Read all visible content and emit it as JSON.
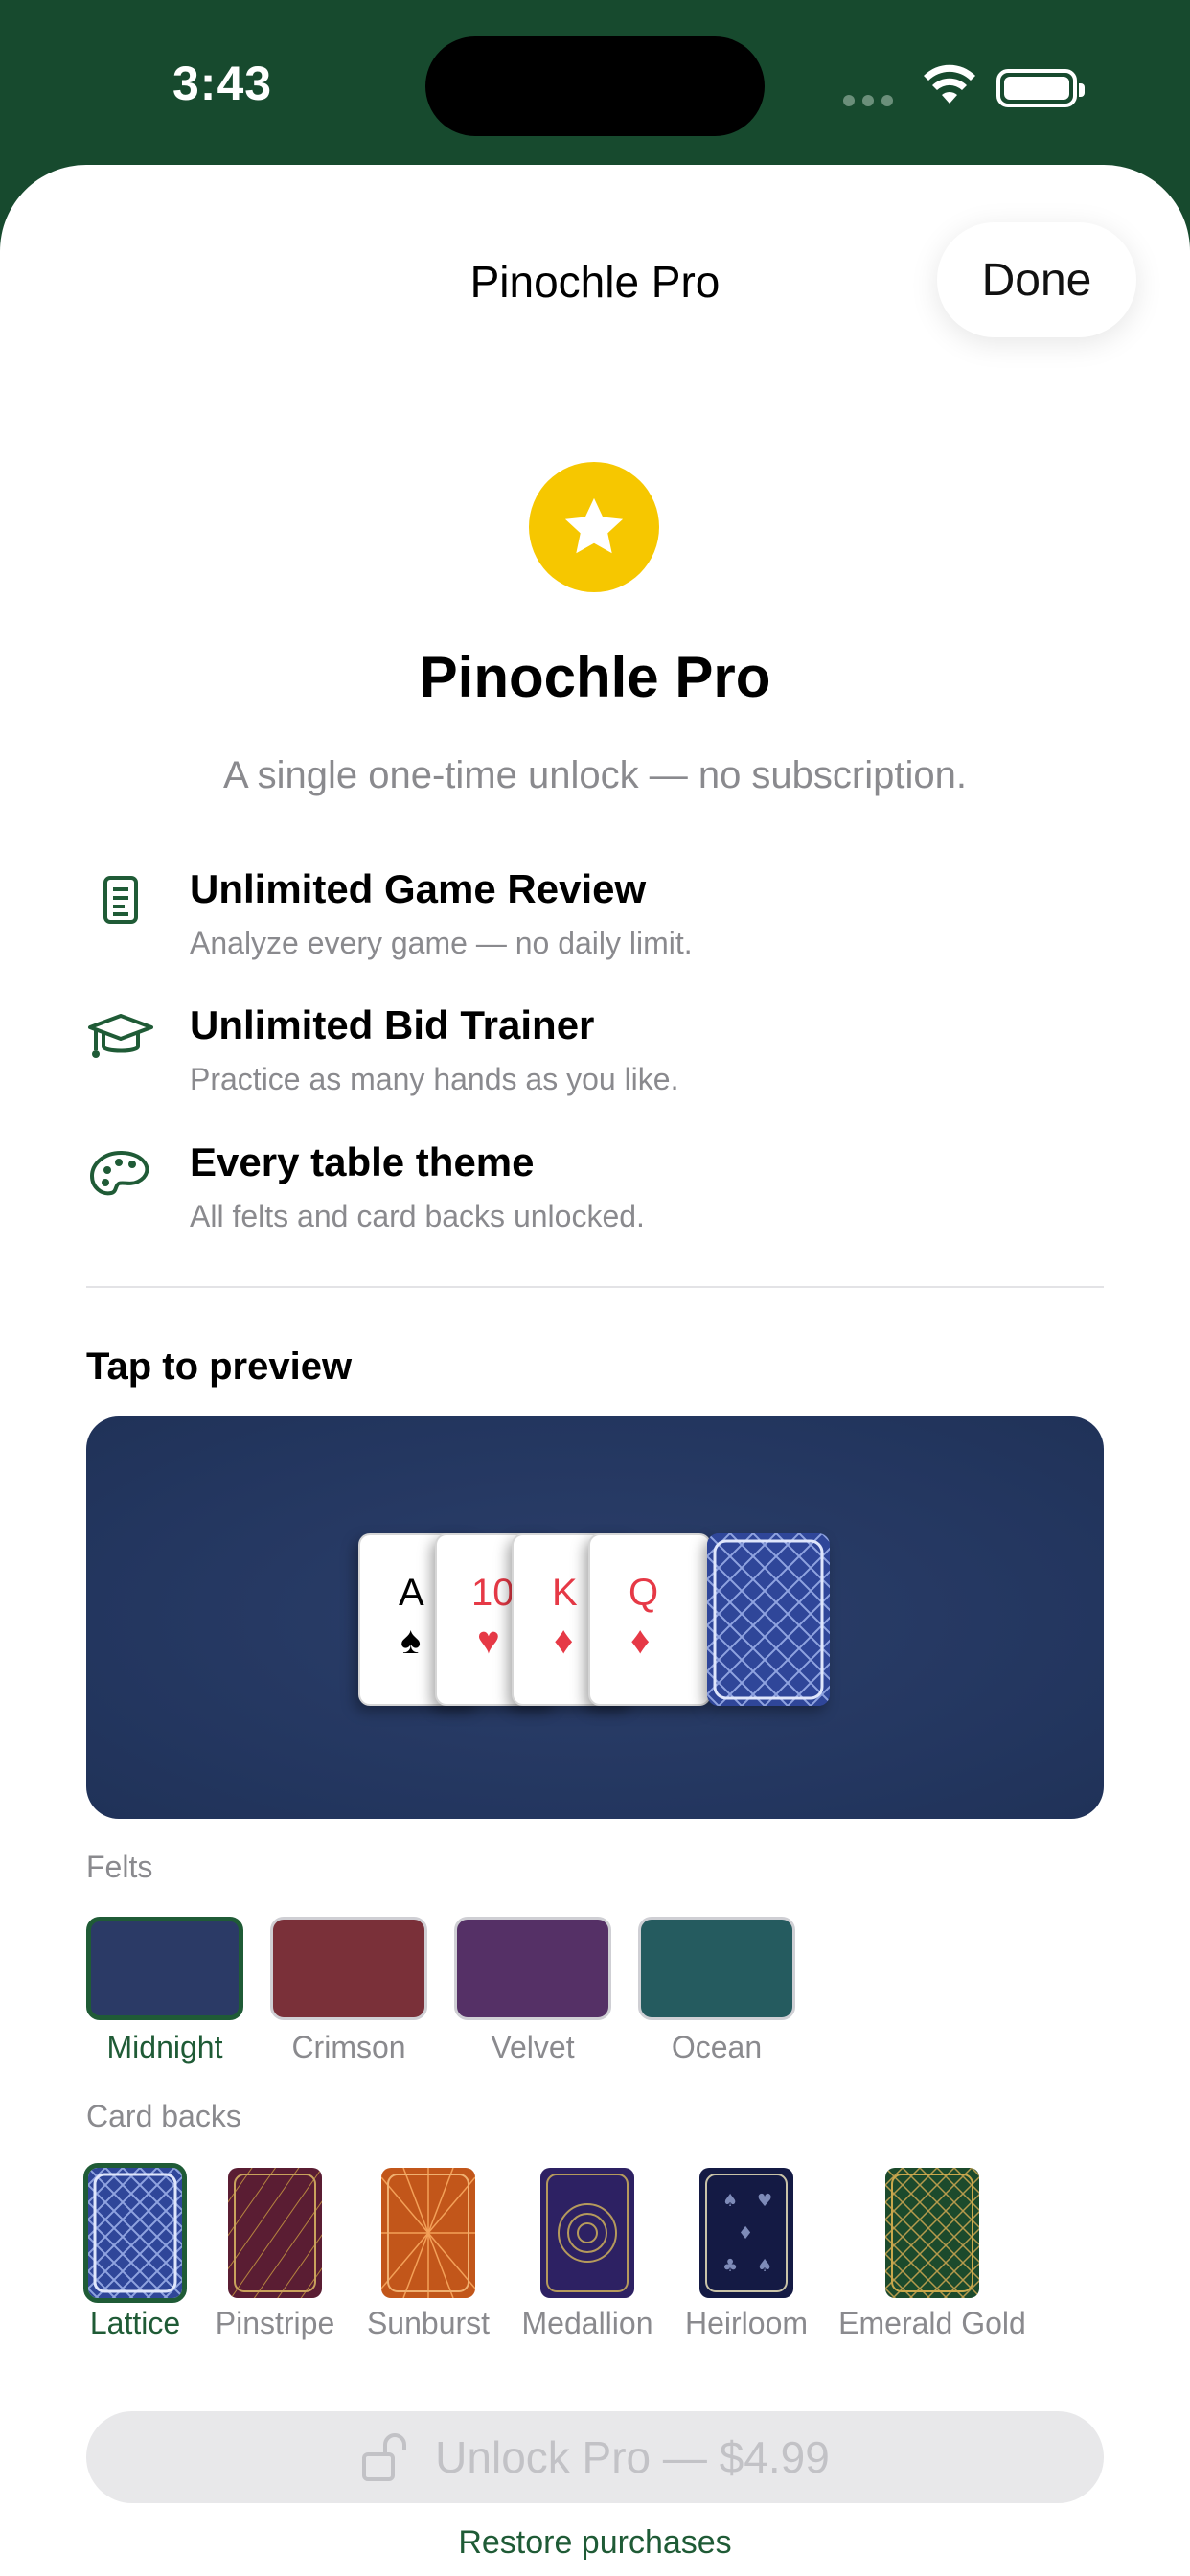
{
  "status_bar": {
    "time": "3:43"
  },
  "header": {
    "title": "Pinochle Pro",
    "done_label": "Done"
  },
  "hero": {
    "icon": "star-icon",
    "title": "Pinochle Pro",
    "subtitle": "A single one-time unlock — no subscription."
  },
  "features": [
    {
      "icon": "document-list-icon",
      "title": "Unlimited Game Review",
      "description": "Analyze every game — no daily limit."
    },
    {
      "icon": "graduation-cap-icon",
      "title": "Unlimited Bid Trainer",
      "description": "Practice as many hands as you like."
    },
    {
      "icon": "palette-icon",
      "title": "Every table theme",
      "description": "All felts and card backs unlocked."
    }
  ],
  "preview": {
    "heading": "Tap to preview",
    "cards": [
      {
        "rank": "A",
        "suit": "♠"
      },
      {
        "rank": "10",
        "suit": "♥"
      },
      {
        "rank": "K",
        "suit": "♦"
      },
      {
        "rank": "Q",
        "suit": "♦"
      }
    ]
  },
  "felts": {
    "label": "Felts",
    "items": [
      {
        "name": "Midnight",
        "color": "#2b3a66",
        "selected": true
      },
      {
        "name": "Crimson",
        "color": "#7a3039"
      },
      {
        "name": "Velvet",
        "color": "#553066"
      },
      {
        "name": "Ocean",
        "color": "#255b5f"
      }
    ]
  },
  "card_backs": {
    "label": "Card backs",
    "items": [
      {
        "name": "Lattice",
        "selected": true
      },
      {
        "name": "Pinstripe"
      },
      {
        "name": "Sunburst"
      },
      {
        "name": "Medallion"
      },
      {
        "name": "Heirloom"
      },
      {
        "name": "Emerald Gold"
      }
    ]
  },
  "footer": {
    "unlock_label": "Unlock Pro — $4.99",
    "restore_label": "Restore purchases"
  },
  "colors": {
    "accent": "#1f5b36",
    "star": "#f6c700",
    "background": "#174a2e"
  }
}
